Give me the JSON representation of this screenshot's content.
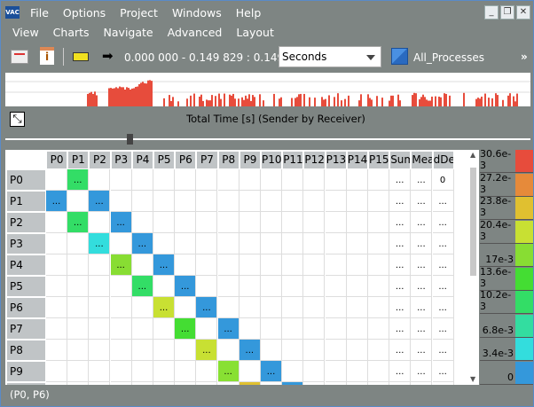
{
  "app": {
    "logo": "VAC"
  },
  "menu1": [
    "File",
    "Options",
    "Project",
    "Windows",
    "Help"
  ],
  "menu2": [
    "View",
    "Charts",
    "Navigate",
    "Advanced",
    "Layout"
  ],
  "window_controls": [
    "_",
    "❐",
    "✕"
  ],
  "toolbar": {
    "time_range": "0.000 000 - 0.149 829 : 0.149 829",
    "unit_select": "Seconds",
    "process_group": "All_Processes",
    "overflow": "»"
  },
  "histogram": [
    0,
    0,
    0,
    0,
    0,
    0,
    0,
    0,
    0,
    0,
    0,
    0,
    0,
    0,
    0,
    0,
    0,
    0,
    0,
    0,
    0,
    0,
    0,
    0,
    0,
    0,
    0,
    0,
    0,
    0,
    0,
    0,
    0,
    0,
    0,
    0,
    0,
    0,
    0,
    0,
    0,
    0,
    0,
    0,
    0,
    0,
    0,
    0,
    0,
    0,
    0,
    0,
    0,
    0,
    0,
    0,
    0,
    0,
    0,
    0,
    0,
    0,
    0,
    0,
    0,
    0,
    0,
    0,
    0,
    0,
    0,
    0,
    0,
    0,
    0,
    0,
    0,
    0,
    0,
    0,
    0,
    0,
    0,
    0,
    0,
    0,
    0,
    0,
    0,
    0,
    0,
    0,
    0,
    0,
    0,
    0,
    0,
    0,
    0,
    0,
    0,
    0,
    0,
    0,
    0,
    0,
    0,
    0,
    0,
    0,
    0,
    0,
    0,
    0,
    0,
    0,
    0,
    0,
    0,
    0,
    0,
    0,
    0,
    0,
    0,
    0,
    0,
    0,
    0,
    0,
    0,
    0,
    0,
    0,
    0,
    0,
    0,
    0,
    0,
    0,
    0,
    0,
    0,
    0,
    0,
    0,
    0,
    0,
    0,
    0,
    0,
    0,
    0,
    0,
    0,
    0,
    0,
    0,
    0,
    0,
    0,
    0,
    0,
    0,
    0,
    0,
    0,
    0,
    0,
    0,
    0,
    0,
    0,
    0,
    0,
    0,
    0,
    0,
    0,
    0,
    0,
    0,
    0,
    0,
    0,
    0,
    0,
    0,
    0,
    0,
    0,
    0,
    0,
    0,
    0,
    0,
    0,
    0,
    0,
    0,
    0,
    0,
    0,
    0,
    0,
    0,
    0,
    0,
    0,
    0,
    0,
    0,
    0,
    0,
    0,
    0,
    0,
    0,
    0,
    0,
    0,
    0,
    0,
    0,
    0,
    0,
    0,
    0,
    0,
    0,
    0,
    0,
    0,
    0,
    0,
    0,
    0,
    0,
    0,
    0,
    0,
    0,
    0,
    0,
    0,
    0,
    0,
    0,
    0,
    0,
    0,
    0,
    0,
    0,
    0,
    0,
    0,
    0,
    0,
    0,
    0,
    0,
    0,
    0,
    0,
    0,
    0,
    0,
    0,
    0,
    0,
    0,
    0,
    0,
    0,
    0,
    0,
    0,
    0,
    0,
    0,
    0,
    0,
    0,
    0,
    0,
    0,
    0,
    0,
    0,
    0,
    0,
    0,
    0,
    0,
    0,
    0,
    0,
    0,
    0,
    0,
    0,
    0,
    0,
    0,
    0,
    0,
    0,
    0,
    0,
    0,
    0,
    0,
    0,
    0
  ],
  "chart_title": "Total Time [s] (Sender by Receiver)",
  "matrix": {
    "columns": [
      "P0",
      "P1",
      "P2",
      "P3",
      "P4",
      "P5",
      "P6",
      "P7",
      "P8",
      "P9",
      "P10",
      "P11",
      "P12",
      "P13",
      "P14",
      "P15",
      "Sum",
      "Mean",
      "dDev"
    ],
    "rows": [
      "P0",
      "P1",
      "P2",
      "P3",
      "P4",
      "P5",
      "P6",
      "P7",
      "P8",
      "P9",
      "P10"
    ],
    "cell_text": "...",
    "ddev_p0": "0",
    "filled": [
      [
        0,
        1,
        "#33dd66"
      ],
      [
        1,
        0,
        "#3498db"
      ],
      [
        1,
        2,
        "#3498db"
      ],
      [
        2,
        1,
        "#33dd66"
      ],
      [
        2,
        3,
        "#3498db"
      ],
      [
        3,
        2,
        "#33dddd"
      ],
      [
        3,
        4,
        "#3498db"
      ],
      [
        4,
        3,
        "#88dd33"
      ],
      [
        4,
        5,
        "#3498db"
      ],
      [
        5,
        4,
        "#33dd66"
      ],
      [
        5,
        6,
        "#3498db"
      ],
      [
        6,
        5,
        "#c8e033"
      ],
      [
        6,
        7,
        "#3498db"
      ],
      [
        7,
        6,
        "#44dd33"
      ],
      [
        7,
        8,
        "#3498db"
      ],
      [
        8,
        7,
        "#c8e033"
      ],
      [
        8,
        9,
        "#3498db"
      ],
      [
        9,
        8,
        "#88e033"
      ],
      [
        9,
        10,
        "#3498db"
      ],
      [
        10,
        9,
        "#e0c030"
      ],
      [
        10,
        11,
        "#3498db"
      ]
    ]
  },
  "legend": [
    {
      "label": "30.6e-3",
      "color": "#e74c3c"
    },
    {
      "label": "27.2e-3",
      "color": "#e68a3a"
    },
    {
      "label": "23.8e-3",
      "color": "#e0c030"
    },
    {
      "label": "20.4e-3",
      "color": "#c8e033"
    },
    {
      "label": "17e-3",
      "color": "#88dd33"
    },
    {
      "label": "13.6e-3",
      "color": "#44dd33"
    },
    {
      "label": "10.2e-3",
      "color": "#33dd66"
    },
    {
      "label": "6.8e-3",
      "color": "#33dda0"
    },
    {
      "label": "3.4e-3",
      "color": "#33dddd"
    },
    {
      "label": "0",
      "color": "#3498db"
    }
  ],
  "status": "(P0, P6)"
}
